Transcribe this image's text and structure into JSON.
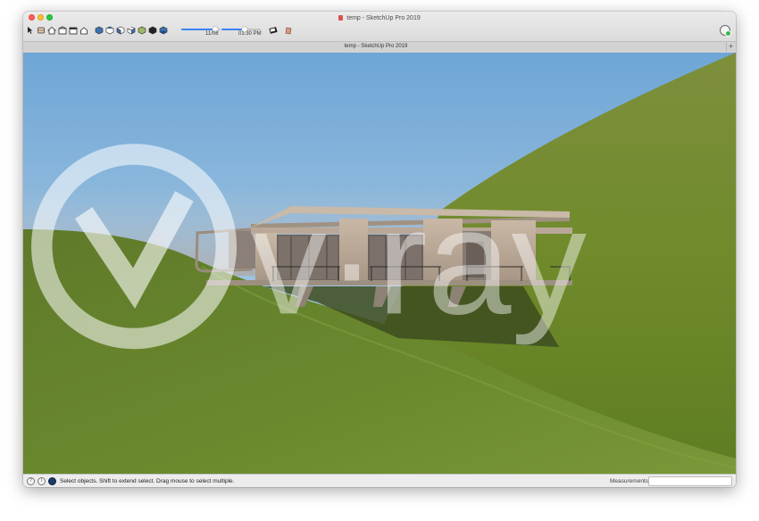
{
  "window": {
    "title": "temp - SketchUp Pro 2019",
    "tab_label": "temp - SketchUp Pro 2019",
    "tab_add": "+"
  },
  "toolbar": {
    "buttons": [
      "select-icon",
      "eraser-icon",
      "home-icon",
      "warehouse-icon",
      "extension-icon",
      "house-icon",
      "cube-front-icon",
      "cube-top-icon",
      "cube-iso-icon",
      "cube-right-icon",
      "cube-back-icon",
      "cube-left-icon",
      "cube-bottom-icon"
    ],
    "date_slider": {
      "label": "11/08",
      "value": 0.86
    },
    "time_slider": {
      "label": "01:30 PM",
      "value": 0.6
    },
    "shadow_toggle": "shadows-icon",
    "fog_toggle": "fog-icon"
  },
  "viewport": {
    "watermark": "v·ray"
  },
  "statusbar": {
    "hint": "Select objects. Shift to extend select. Drag mouse to select multiple.",
    "measurements_label": "Measurements",
    "measurements_value": ""
  },
  "colors": {
    "sky_top": "#7fb0d9",
    "sky_horizon": "#b8d0e3",
    "grass": "#6b8a2e",
    "accent": "#3b82f6"
  }
}
